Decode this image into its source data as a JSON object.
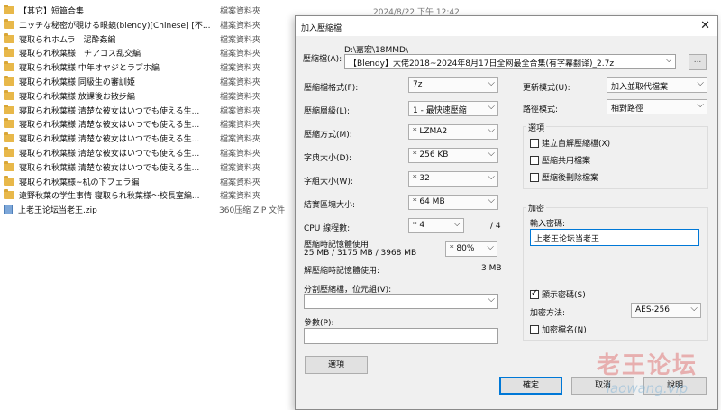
{
  "background": {
    "date": "2024/8/22 下午 12:42",
    "files": [
      {
        "name": "【其它】短篇合集",
        "type": "檔案資料夾",
        "icon": "folder"
      },
      {
        "name": "エッチな秘密が覗ける眼鏡(blendy)[Chinese] [不...",
        "type": "檔案資料夾",
        "icon": "folder"
      },
      {
        "name": "寝取られホムラ　泥酔姦編",
        "type": "檔案資料夾",
        "icon": "folder"
      },
      {
        "name": "寝取られ秋葉様　チアコス乱交編",
        "type": "檔案資料夾",
        "icon": "folder"
      },
      {
        "name": "寝取られ秋葉様 中年オヤジとラブホ編",
        "type": "檔案資料夾",
        "icon": "folder"
      },
      {
        "name": "寝取られ秋葉様 同級生の審訓姫",
        "type": "檔案資料夾",
        "icon": "folder"
      },
      {
        "name": "寝取られ秋葉様 放課後お散步編",
        "type": "檔案資料夾",
        "icon": "folder"
      },
      {
        "name": "寝取られ秋葉様 清楚な彼女はいつでも使える生...",
        "type": "檔案資料夾",
        "icon": "folder"
      },
      {
        "name": "寝取られ秋葉様 清楚な彼女はいつでも使える生...",
        "type": "檔案資料夾",
        "icon": "folder"
      },
      {
        "name": "寝取られ秋葉様 清楚な彼女はいつでも使える生...",
        "type": "檔案資料夾",
        "icon": "folder"
      },
      {
        "name": "寝取られ秋葉様 清楚な彼女はいつでも使える生...",
        "type": "檔案資料夾",
        "icon": "folder"
      },
      {
        "name": "寝取られ秋葉様 清楚な彼女はいつでも使える生...",
        "type": "檔案資料夾",
        "icon": "folder"
      },
      {
        "name": "寝取られ秋葉様~机の下フェラ編",
        "type": "檔案資料夾",
        "icon": "folder"
      },
      {
        "name": "遠野秋葉の学生事情 寝取られ秋葉様～校長室編...",
        "type": "檔案資料夾",
        "icon": "folder"
      },
      {
        "name": "上老王论坛当老王.zip",
        "type": "360压缩 ZIP 文件",
        "icon": "zip"
      }
    ]
  },
  "dialog": {
    "title": "加入壓縮檔",
    "close": "✕",
    "archive_label": "壓縮檔(A):",
    "archive_path": "D:\\嘉宏\\18MMD\\",
    "archive_name": "【Blendy】大佬2018~2024年8月17日全网最全合集(有字幕翻译)_2.7z",
    "browse": "...",
    "format_label": "壓縮檔格式(F):",
    "format_value": "7z",
    "level_label": "壓縮層級(L):",
    "level_value": "1 - 最快速壓縮",
    "method_label": "壓縮方式(M):",
    "method_value": "* LZMA2",
    "dict_label": "字典大小(D):",
    "dict_value": "* 256 KB",
    "word_label": "字組大小(W):",
    "word_value": "* 32",
    "solid_label": "結實區塊大小:",
    "solid_value": "* 64 MB",
    "cpu_label": "CPU 線程數:",
    "cpu_value": "* 4",
    "cpu_total": "/ 4",
    "mem_label": "壓縮時記憶體使用:",
    "mem_value": "25 MB / 3175 MB / 3968 MB",
    "mem_pct": "* 80%",
    "demem_label": "解壓縮時記憶體使用:",
    "demem_value": "3 MB",
    "split_label": "分割壓縮檔，位元組(V):",
    "split_value": "",
    "params_label": "參數(P):",
    "params_value": "",
    "options_button": "選項",
    "update_label": "更新模式(U):",
    "update_value": "加入並取代檔案",
    "path_label": "路徑模式:",
    "path_value": "相對路徑",
    "options_group": "選項",
    "opt_sfx": "建立自解壓縮檔(X)",
    "opt_shared": "壓縮共用檔案",
    "opt_delete": "壓縮後刪除檔案",
    "enc_group": "加密",
    "pwd_label": "輸入密碼:",
    "pwd_value": "上老王论坛当老王",
    "show_pwd": "顯示密碼(S)",
    "enc_method_label": "加密方法:",
    "enc_method_value": "AES-256",
    "enc_names": "加密檔名(N)",
    "ok": "確定",
    "cancel": "取消",
    "help": "說明"
  },
  "watermark": {
    "line1": "老王论坛",
    "line2": "laowang.vip"
  }
}
